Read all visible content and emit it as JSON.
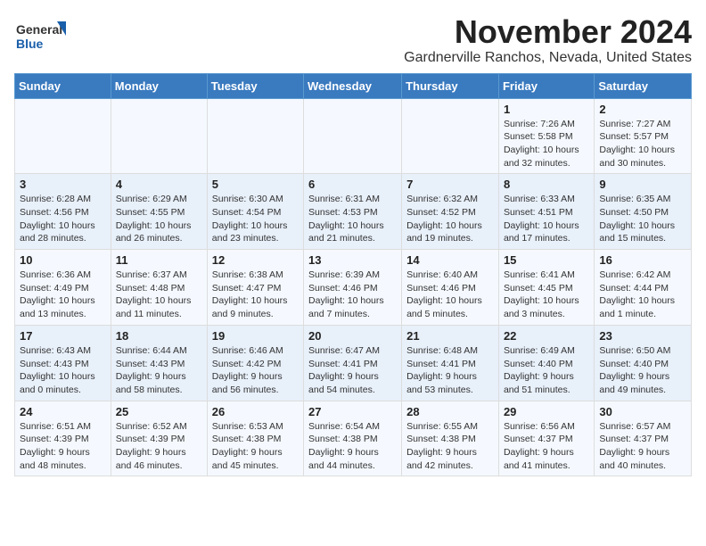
{
  "logo": {
    "line1": "General",
    "line2": "Blue"
  },
  "title": "November 2024",
  "location": "Gardnerville Ranchos, Nevada, United States",
  "weekdays": [
    "Sunday",
    "Monday",
    "Tuesday",
    "Wednesday",
    "Thursday",
    "Friday",
    "Saturday"
  ],
  "weeks": [
    [
      {
        "day": "",
        "text": ""
      },
      {
        "day": "",
        "text": ""
      },
      {
        "day": "",
        "text": ""
      },
      {
        "day": "",
        "text": ""
      },
      {
        "day": "",
        "text": ""
      },
      {
        "day": "1",
        "text": "Sunrise: 7:26 AM\nSunset: 5:58 PM\nDaylight: 10 hours and 32 minutes."
      },
      {
        "day": "2",
        "text": "Sunrise: 7:27 AM\nSunset: 5:57 PM\nDaylight: 10 hours and 30 minutes."
      }
    ],
    [
      {
        "day": "3",
        "text": "Sunrise: 6:28 AM\nSunset: 4:56 PM\nDaylight: 10 hours and 28 minutes."
      },
      {
        "day": "4",
        "text": "Sunrise: 6:29 AM\nSunset: 4:55 PM\nDaylight: 10 hours and 26 minutes."
      },
      {
        "day": "5",
        "text": "Sunrise: 6:30 AM\nSunset: 4:54 PM\nDaylight: 10 hours and 23 minutes."
      },
      {
        "day": "6",
        "text": "Sunrise: 6:31 AM\nSunset: 4:53 PM\nDaylight: 10 hours and 21 minutes."
      },
      {
        "day": "7",
        "text": "Sunrise: 6:32 AM\nSunset: 4:52 PM\nDaylight: 10 hours and 19 minutes."
      },
      {
        "day": "8",
        "text": "Sunrise: 6:33 AM\nSunset: 4:51 PM\nDaylight: 10 hours and 17 minutes."
      },
      {
        "day": "9",
        "text": "Sunrise: 6:35 AM\nSunset: 4:50 PM\nDaylight: 10 hours and 15 minutes."
      }
    ],
    [
      {
        "day": "10",
        "text": "Sunrise: 6:36 AM\nSunset: 4:49 PM\nDaylight: 10 hours and 13 minutes."
      },
      {
        "day": "11",
        "text": "Sunrise: 6:37 AM\nSunset: 4:48 PM\nDaylight: 10 hours and 11 minutes."
      },
      {
        "day": "12",
        "text": "Sunrise: 6:38 AM\nSunset: 4:47 PM\nDaylight: 10 hours and 9 minutes."
      },
      {
        "day": "13",
        "text": "Sunrise: 6:39 AM\nSunset: 4:46 PM\nDaylight: 10 hours and 7 minutes."
      },
      {
        "day": "14",
        "text": "Sunrise: 6:40 AM\nSunset: 4:46 PM\nDaylight: 10 hours and 5 minutes."
      },
      {
        "day": "15",
        "text": "Sunrise: 6:41 AM\nSunset: 4:45 PM\nDaylight: 10 hours and 3 minutes."
      },
      {
        "day": "16",
        "text": "Sunrise: 6:42 AM\nSunset: 4:44 PM\nDaylight: 10 hours and 1 minute."
      }
    ],
    [
      {
        "day": "17",
        "text": "Sunrise: 6:43 AM\nSunset: 4:43 PM\nDaylight: 10 hours and 0 minutes."
      },
      {
        "day": "18",
        "text": "Sunrise: 6:44 AM\nSunset: 4:43 PM\nDaylight: 9 hours and 58 minutes."
      },
      {
        "day": "19",
        "text": "Sunrise: 6:46 AM\nSunset: 4:42 PM\nDaylight: 9 hours and 56 minutes."
      },
      {
        "day": "20",
        "text": "Sunrise: 6:47 AM\nSunset: 4:41 PM\nDaylight: 9 hours and 54 minutes."
      },
      {
        "day": "21",
        "text": "Sunrise: 6:48 AM\nSunset: 4:41 PM\nDaylight: 9 hours and 53 minutes."
      },
      {
        "day": "22",
        "text": "Sunrise: 6:49 AM\nSunset: 4:40 PM\nDaylight: 9 hours and 51 minutes."
      },
      {
        "day": "23",
        "text": "Sunrise: 6:50 AM\nSunset: 4:40 PM\nDaylight: 9 hours and 49 minutes."
      }
    ],
    [
      {
        "day": "24",
        "text": "Sunrise: 6:51 AM\nSunset: 4:39 PM\nDaylight: 9 hours and 48 minutes."
      },
      {
        "day": "25",
        "text": "Sunrise: 6:52 AM\nSunset: 4:39 PM\nDaylight: 9 hours and 46 minutes."
      },
      {
        "day": "26",
        "text": "Sunrise: 6:53 AM\nSunset: 4:38 PM\nDaylight: 9 hours and 45 minutes."
      },
      {
        "day": "27",
        "text": "Sunrise: 6:54 AM\nSunset: 4:38 PM\nDaylight: 9 hours and 44 minutes."
      },
      {
        "day": "28",
        "text": "Sunrise: 6:55 AM\nSunset: 4:38 PM\nDaylight: 9 hours and 42 minutes."
      },
      {
        "day": "29",
        "text": "Sunrise: 6:56 AM\nSunset: 4:37 PM\nDaylight: 9 hours and 41 minutes."
      },
      {
        "day": "30",
        "text": "Sunrise: 6:57 AM\nSunset: 4:37 PM\nDaylight: 9 hours and 40 minutes."
      }
    ]
  ]
}
